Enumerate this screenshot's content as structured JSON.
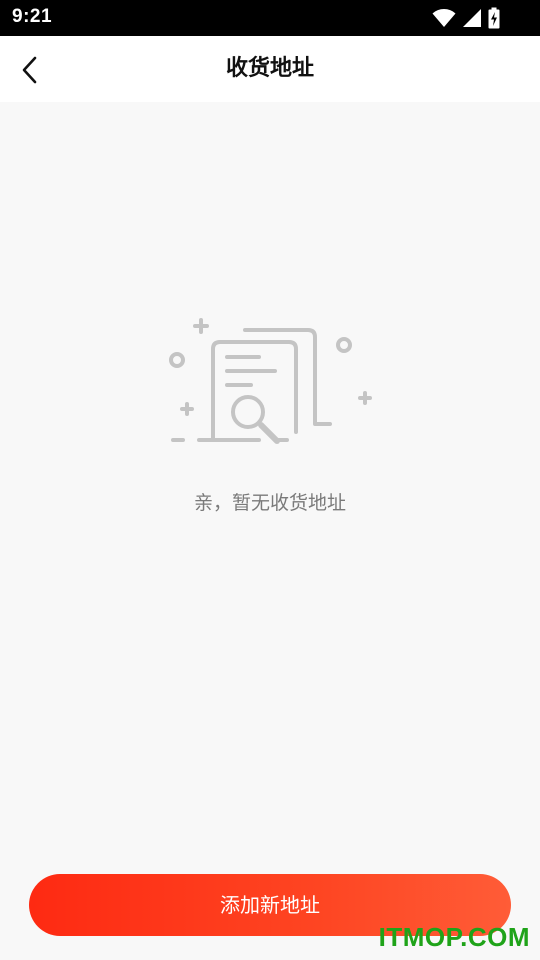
{
  "status_bar": {
    "time": "9:21",
    "icons": [
      "wifi-icon",
      "cell-signal-icon",
      "battery-charging-icon"
    ]
  },
  "nav": {
    "back_icon": "chevron-left-icon",
    "title": "收货地址"
  },
  "empty_state": {
    "illustration": "empty-documents-search-icon",
    "message": "亲，暂无收货地址"
  },
  "footer": {
    "add_button_label": "添加新地址"
  },
  "watermark": {
    "text": "ITMOP.COM"
  },
  "colors": {
    "accent_start": "#fe2a12",
    "accent_end": "#ff5c37",
    "background": "#f8f8f8",
    "watermark": "#1fa319"
  }
}
